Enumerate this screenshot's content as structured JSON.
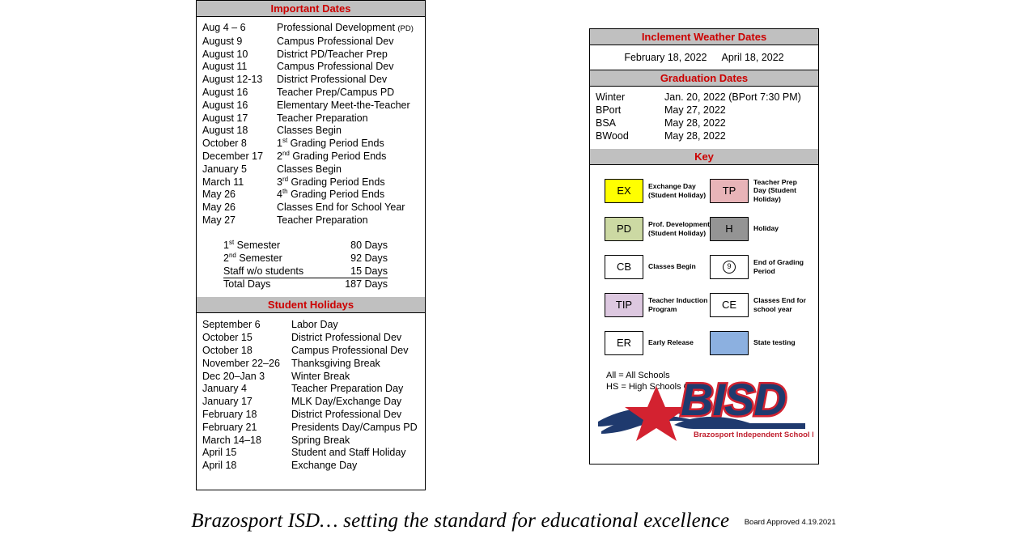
{
  "left_panel": {
    "important_dates_header": "Important Dates",
    "important_dates": [
      {
        "date": "Aug 4 – 6",
        "event": "Professional Development ",
        "event_small": "(PD)"
      },
      {
        "date": "August 9",
        "event": "Campus Professional Dev"
      },
      {
        "date": "August 10",
        "event": "District PD/Teacher Prep"
      },
      {
        "date": "August 11",
        "event": "Campus Professional Dev"
      },
      {
        "date": "August 12-13",
        "event": "District Professional Dev"
      },
      {
        "date": "August 16",
        "event": "Teacher Prep/Campus PD"
      },
      {
        "date": "August 16",
        "event": "Elementary Meet-the-Teacher"
      },
      {
        "date": "August 17",
        "event": "Teacher Preparation"
      },
      {
        "date": "August 18",
        "event": "Classes Begin"
      },
      {
        "date": "October 8",
        "event": "Grading Period Ends",
        "ordinal": "1",
        "sup": "st"
      },
      {
        "date": "December 17",
        "event": "Grading Period Ends",
        "ordinal": "2",
        "sup": "nd"
      },
      {
        "date": "January 5",
        "event": "Classes Begin"
      },
      {
        "date": "March 11",
        "event": "Grading Period Ends",
        "ordinal": "3",
        "sup": "rd"
      },
      {
        "date": "May 26",
        "event": "Grading Period Ends",
        "ordinal": "4",
        "sup": "th"
      },
      {
        "date": "May 26",
        "event": "Classes End for School Year"
      },
      {
        "date": "May 27",
        "event": "Teacher Preparation"
      }
    ],
    "summary": [
      {
        "label": "Semester",
        "ordinal": "1",
        "sup": "st",
        "value": "80 Days"
      },
      {
        "label": "Semester",
        "ordinal": "2",
        "sup": "nd",
        "value": "92 Days"
      },
      {
        "label": "Staff w/o students",
        "value": "15 Days",
        "underline": true
      },
      {
        "label": "Total Days",
        "value": "187 Days"
      }
    ],
    "student_holidays_header": "Student Holidays",
    "student_holidays": [
      {
        "date": "September 6",
        "event": "Labor Day"
      },
      {
        "date": "October 15",
        "event": "District Professional Dev"
      },
      {
        "date": "October 18",
        "event": "Campus Professional Dev"
      },
      {
        "date": "November 22–26",
        "event": "Thanksgiving Break"
      },
      {
        "date": "Dec 20–Jan 3",
        "event": "Winter Break"
      },
      {
        "date": "January 4",
        "event": "Teacher Preparation Day"
      },
      {
        "date": "January 17",
        "event": "MLK Day/Exchange Day"
      },
      {
        "date": "February 18",
        "event": "District Professional Dev"
      },
      {
        "date": "February 21",
        "event": "Presidents Day/Campus PD"
      },
      {
        "date": "March 14–18",
        "event": "Spring Break"
      },
      {
        "date": "April 15",
        "event": "Student and Staff Holiday"
      },
      {
        "date": "April 18",
        "event": "Exchange Day"
      }
    ]
  },
  "right_panel": {
    "inclement_header": "Inclement Weather Dates",
    "inclement_dates": [
      "February 18, 2022",
      "April 18, 2022"
    ],
    "graduation_header": "Graduation Dates",
    "graduation_dates": [
      {
        "school": "Winter",
        "date": "Jan. 20, 2022 (BPort 7:30 PM)"
      },
      {
        "school": "BPort",
        "date": "May 27, 2022"
      },
      {
        "school": "BSA",
        "date": "May 28, 2022"
      },
      {
        "school": "BWood",
        "date": "May 28, 2022"
      }
    ],
    "key_header": "Key",
    "key_items_left": [
      {
        "code": "EX",
        "label": "Exchange Day\n(Student Holiday)",
        "color": "#ffff00",
        "icon": "exchange-day-swatch"
      },
      {
        "code": "PD",
        "label": "Prof. Development\n(Student Holiday)",
        "color": "#ccd9a3",
        "icon": "prof-development-swatch"
      },
      {
        "code": "CB",
        "label": "Classes Begin",
        "color": "#ffffff",
        "icon": "classes-begin-swatch"
      },
      {
        "code": "TIP",
        "label": "Teacher Induction\nProgram",
        "color": "#ddc8e0",
        "icon": "teacher-induction-swatch"
      },
      {
        "code": "ER",
        "label": "Early Release",
        "color": "#ffffff",
        "icon": "early-release-swatch"
      }
    ],
    "key_items_right": [
      {
        "code": "TP",
        "label": "Teacher Prep\nDay (Student\nHoliday)",
        "color": "#e8b4b8",
        "icon": "teacher-prep-swatch"
      },
      {
        "code": "H",
        "label": "Holiday",
        "color": "#949494",
        "icon": "holiday-swatch"
      },
      {
        "code": "9",
        "label": "End of Grading\nPeriod",
        "color": "#ffffff",
        "icon": "end-of-grading-period-swatch",
        "circled": true
      },
      {
        "code": "CE",
        "label": "Classes End for\nschool year",
        "color": "#ffffff",
        "icon": "classes-end-swatch"
      },
      {
        "code": "",
        "label": "State testing",
        "color": "#8cb0e0",
        "icon": "state-testing-swatch"
      }
    ],
    "key_notes": [
      "All = All Schools",
      "HS = High Schools Only"
    ],
    "logo": {
      "name": "BISD",
      "tagline": "Brazosport Independent School District",
      "star_color": "#d32230",
      "text_color": "#1f3a6e"
    }
  },
  "footer": {
    "tagline": "Brazosport ISD… setting the standard for educational excellence",
    "approved": "Board Approved 4.19.2021"
  },
  "colors": {
    "header_red": "#cc0000",
    "header_gray": "#c0c0c0"
  }
}
